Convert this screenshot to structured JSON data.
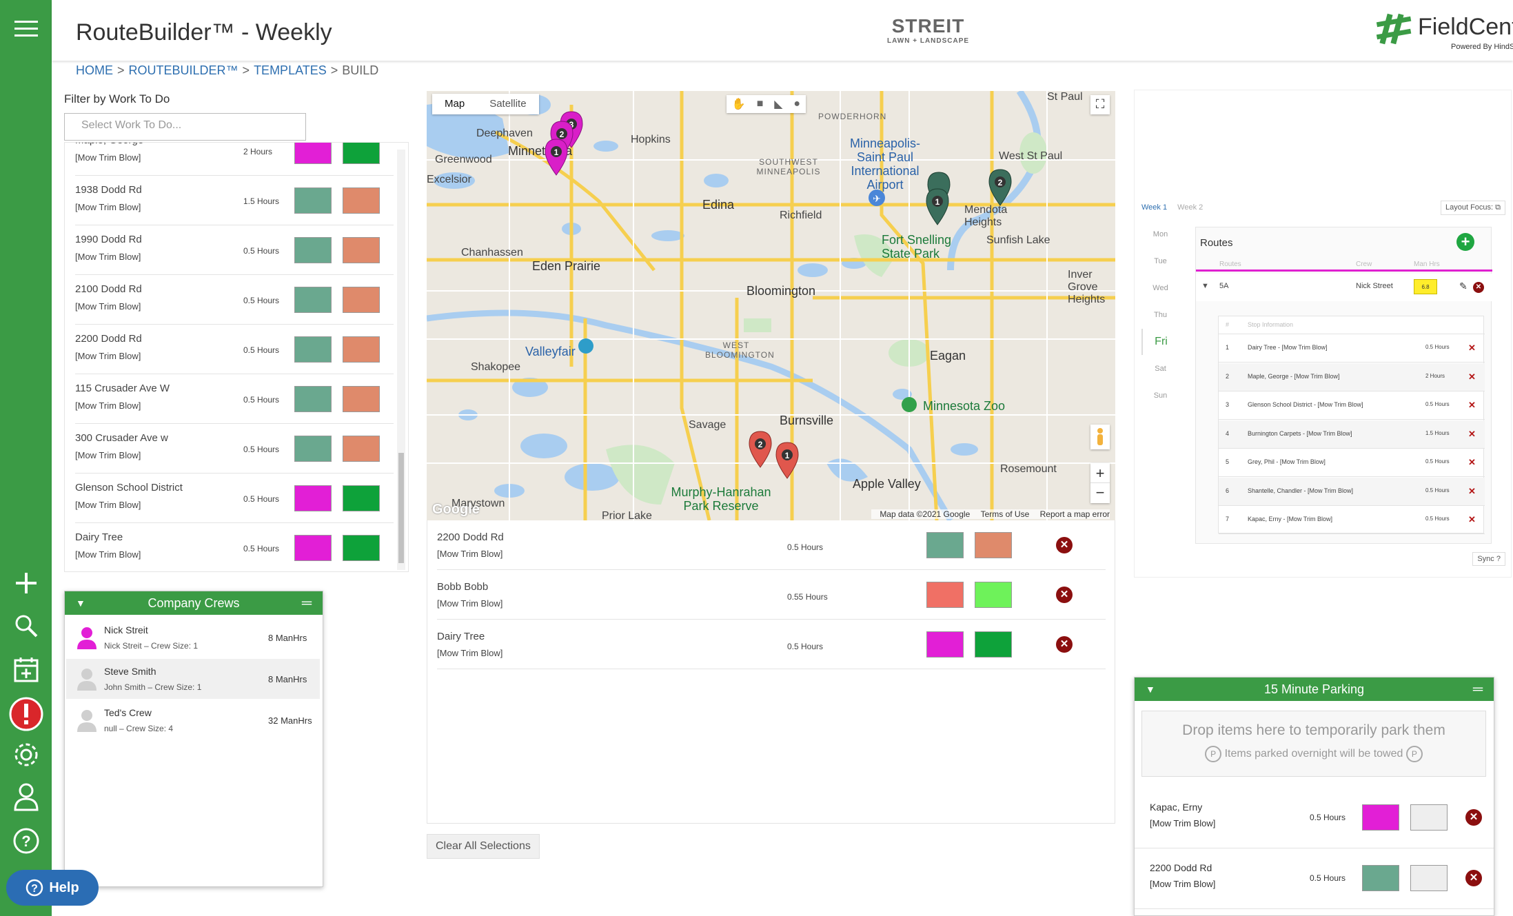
{
  "header": {
    "title": "RouteBuilder™ - Weekly",
    "breadcrumb": [
      "HOME",
      "ROUTEBUILDER™",
      "TEMPLATES",
      "BUILD"
    ],
    "client_logo": {
      "name": "STREIT",
      "tagline": "LAWN + LANDSCAPE"
    },
    "brand_logo": {
      "name": "FieldCentral",
      "tagline": "Powered By HindSite"
    }
  },
  "filter": {
    "label": "Filter by Work To Do",
    "placeholder": "Select Work To Do..."
  },
  "job_list": [
    {
      "name": "Maple, George",
      "work": "[Mow Trim Blow]",
      "hours": "2 Hours",
      "color1": "#e21fd6",
      "color2": "#0ea23a"
    },
    {
      "name": "1938 Dodd Rd",
      "work": "[Mow Trim Blow]",
      "hours": "1.5 Hours",
      "color1": "#6aa88f",
      "color2": "#df8a6b"
    },
    {
      "name": "1990 Dodd Rd",
      "work": "[Mow Trim Blow]",
      "hours": "0.5 Hours",
      "color1": "#6aa88f",
      "color2": "#df8a6b"
    },
    {
      "name": "2100 Dodd Rd",
      "work": "[Mow Trim Blow]",
      "hours": "0.5 Hours",
      "color1": "#6aa88f",
      "color2": "#df8a6b"
    },
    {
      "name": "2200 Dodd Rd",
      "work": "[Mow Trim Blow]",
      "hours": "0.5 Hours",
      "color1": "#6aa88f",
      "color2": "#df8a6b"
    },
    {
      "name": "115 Crusader Ave W",
      "work": "[Mow Trim Blow]",
      "hours": "0.5 Hours",
      "color1": "#6aa88f",
      "color2": "#df8a6b"
    },
    {
      "name": "300 Crusader Ave w",
      "work": "[Mow Trim Blow]",
      "hours": "0.5 Hours",
      "color1": "#6aa88f",
      "color2": "#df8a6b"
    },
    {
      "name": "Glenson School District",
      "work": "[Mow Trim Blow]",
      "hours": "0.5 Hours",
      "color1": "#e21fd6",
      "color2": "#0ea23a"
    },
    {
      "name": "Dairy Tree",
      "work": "[Mow Trim Blow]",
      "hours": "0.5 Hours",
      "color1": "#e21fd6",
      "color2": "#0ea23a"
    }
  ],
  "crews": {
    "title": "Company Crews",
    "items": [
      {
        "name": "Nick Streit",
        "sub": "Nick Streit – Crew Size: 1",
        "manhrs": "8 ManHrs",
        "avatar_color": "#e21fd6"
      },
      {
        "name": "Steve Smith",
        "sub": "John Smith – Crew Size: 1",
        "manhrs": "8 ManHrs",
        "avatar_color": "#cfcfcf"
      },
      {
        "name": "Ted's Crew",
        "sub": "null – Crew Size: 4",
        "manhrs": "32 ManHrs",
        "avatar_color": "#cfcfcf"
      }
    ]
  },
  "help": {
    "label": "Help"
  },
  "map": {
    "tabs": [
      "Map",
      "Satellite"
    ],
    "footer": [
      "Map data ©2021 Google",
      "Terms of Use",
      "Report a map error"
    ],
    "places": [
      "Deephaven",
      "Minnetonka",
      "Hopkins",
      "Greenwood",
      "Excelsior",
      "Edina",
      "Richfield",
      "Minneapolis-Saint Paul International Airport",
      "Chanhassen",
      "Eden Prairie",
      "Bloomington",
      "Fort Snelling State Park",
      "Valleyfair",
      "Shakopee",
      "WEST BLOOMINGTON",
      "Eagan",
      "Minnesota Zoo",
      "Savage",
      "Burnsville",
      "Apple Valley",
      "Murphy-Hanrahan Park Reserve",
      "Prior Lake",
      "Marystown",
      "Rosemount",
      "Mendota Heights",
      "Sunfish Lake",
      "Inver Grove Heights",
      "West St Paul",
      "St Paul",
      "POWDERHORN",
      "SOUTHWEST MINNEAPOLIS"
    ],
    "pin_labels": [
      "1",
      "2",
      "3",
      "2",
      "1",
      "2",
      "1"
    ],
    "pin_colors": {
      "magenta": "#d91fc8",
      "dark_green": "#3b6e5c",
      "red": "#e0574d"
    }
  },
  "selected_stops": [
    {
      "name": "2200 Dodd Rd",
      "work": "[Mow Trim Blow]",
      "hours": "0.5 Hours",
      "color1": "#6aa88f",
      "color2": "#df8a6b"
    },
    {
      "name": "Bobb Bobb",
      "work": "[Mow Trim Blow]",
      "hours": "0.55 Hours",
      "color1": "#f07065",
      "color2": "#6ef25a"
    },
    {
      "name": "Dairy Tree",
      "work": "[Mow Trim Blow]",
      "hours": "0.5 Hours",
      "color1": "#e21fd6",
      "color2": "#0ea23a"
    }
  ],
  "clear_button": "Clear All Selections",
  "schedule": {
    "weeks": [
      "Week 1",
      "Week 2"
    ],
    "layout_focus": "Layout Focus:",
    "days": [
      "Mon",
      "Tue",
      "Wed",
      "Thu",
      "Fri",
      "Sat",
      "Sun"
    ],
    "active_day": "Fri",
    "routes_title": "Routes",
    "columns": [
      "Routes",
      "Crew",
      "Man Hrs"
    ],
    "route": {
      "name": "5A",
      "crew": "Nick Street",
      "manhrs": "6.8"
    },
    "stop_header": [
      "#",
      "Stop Information"
    ],
    "stops": [
      {
        "num": "1",
        "info": "Dairy Tree - [Mow Trim Blow]",
        "hours": "0.5 Hours"
      },
      {
        "num": "2",
        "info": "Maple, George - [Mow Trim Blow]",
        "hours": "2 Hours"
      },
      {
        "num": "3",
        "info": "Glenson School District - [Mow Trim Blow]",
        "hours": "0.5 Hours"
      },
      {
        "num": "4",
        "info": "Burnington Carpets - [Mow Trim Blow]",
        "hours": "1.5 Hours"
      },
      {
        "num": "5",
        "info": "Grey, Phil - [Mow Trim Blow]",
        "hours": "0.5 Hours"
      },
      {
        "num": "6",
        "info": "Shantelle, Chandler - [Mow Trim Blow]",
        "hours": "0.5 Hours"
      },
      {
        "num": "7",
        "info": "Kapac, Erny - [Mow Trim Blow]",
        "hours": "0.5 Hours"
      }
    ],
    "sync": "Sync"
  },
  "parking": {
    "title": "15 Minute Parking",
    "drop_text": "Drop items here to temporarily park them",
    "tow_text": "Items parked overnight will be towed",
    "items": [
      {
        "name": "Kapac, Erny",
        "work": "[Mow Trim Blow]",
        "hours": "0.5 Hours",
        "color1": "#e21fd6",
        "color2": "#eeeeee"
      },
      {
        "name": "2200 Dodd Rd",
        "work": "[Mow Trim Blow]",
        "hours": "0.5 Hours",
        "color1": "#6aa88f",
        "color2": "#eeeeee"
      }
    ]
  }
}
